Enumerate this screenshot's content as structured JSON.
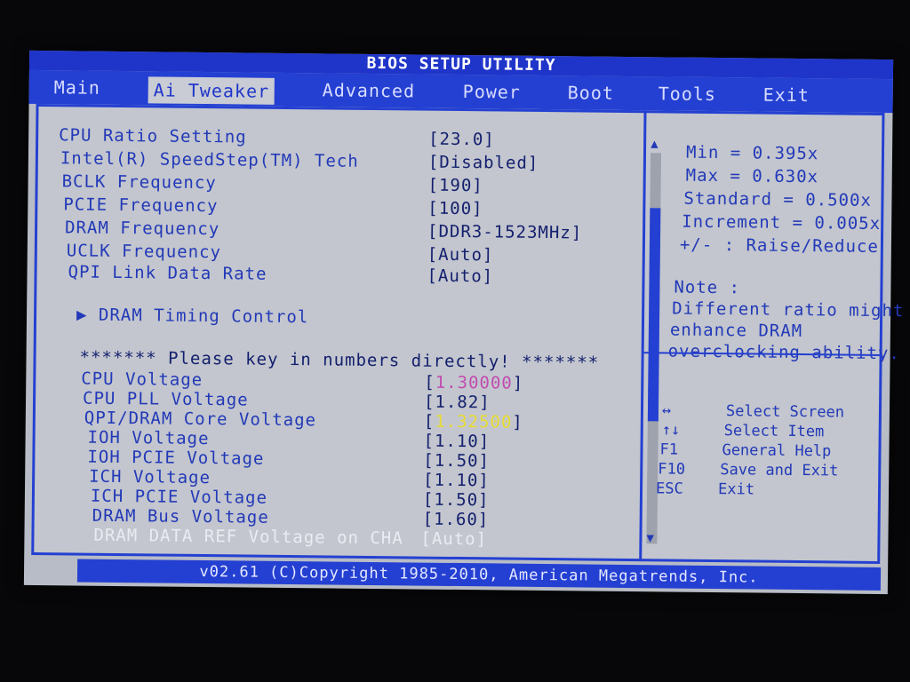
{
  "title": "BIOS SETUP UTILITY",
  "tabs": [
    {
      "label": "Main"
    },
    {
      "label": "Ai Tweaker"
    },
    {
      "label": "Advanced"
    },
    {
      "label": "Power"
    },
    {
      "label": "Boot"
    },
    {
      "label": "Tools"
    },
    {
      "label": "Exit"
    }
  ],
  "settings": [
    {
      "label": "CPU Ratio Setting",
      "value": "[23.0]"
    },
    {
      "label": "Intel(R) SpeedStep(TM) Tech",
      "value": "[Disabled]"
    },
    {
      "label": "BCLK Frequency",
      "value": "[190]"
    },
    {
      "label": "PCIE Frequency",
      "value": "[100]"
    },
    {
      "label": "DRAM Frequency",
      "value": "[DDR3-1523MHz]"
    },
    {
      "label": "UCLK Frequency",
      "value": "[Auto]"
    },
    {
      "label": "QPI Link Data Rate",
      "value": "[Auto]"
    }
  ],
  "submenu": {
    "label": "DRAM Timing Control",
    "arrow": "▶"
  },
  "notice": "******* Please key in numbers directly! *******",
  "voltages": [
    {
      "label": "CPU Voltage",
      "value_open": "[",
      "value_inner": "1.30000",
      "value_close": "]",
      "color": "#c24bb0"
    },
    {
      "label": "CPU PLL Voltage",
      "value": "[1.82]"
    },
    {
      "label": "QPI/DRAM Core Voltage",
      "value_open": "[",
      "value_inner": "1.32500",
      "value_close": "]",
      "color": "#e8dc33"
    },
    {
      "label": "IOH Voltage",
      "value": "[1.10]"
    },
    {
      "label": "IOH PCIE Voltage",
      "value": "[1.50]"
    },
    {
      "label": "ICH Voltage",
      "value": "[1.10]"
    },
    {
      "label": "ICH PCIE Voltage",
      "value": "[1.50]"
    },
    {
      "label": "DRAM Bus Voltage",
      "value": "[1.60]"
    },
    {
      "label": "DRAM DATA REF Voltage on CHA",
      "value": "[Auto]"
    }
  ],
  "help": {
    "min": "Min = 0.395x",
    "max": "Max = 0.630x",
    "standard": "Standard  = 0.500x",
    "increment": "Increment = 0.005x",
    "raise": "+/- : Raise/Reduce",
    "note_title": "Note :",
    "note_lines": [
      "Different ratio might",
      "enhance DRAM",
      "overclocking ability."
    ]
  },
  "keys": [
    {
      "key": "↔",
      "desc": "Select Screen"
    },
    {
      "key": "↑↓",
      "desc": "Select Item"
    },
    {
      "key": "F1",
      "desc": "General Help"
    },
    {
      "key": "F10",
      "desc": "Save and Exit"
    },
    {
      "key": "ESC",
      "desc": "Exit"
    }
  ],
  "footer": "v02.61 (C)Copyright 1985-2010, American Megatrends, Inc.",
  "scroll": {
    "up": "▲",
    "down": "▼"
  }
}
